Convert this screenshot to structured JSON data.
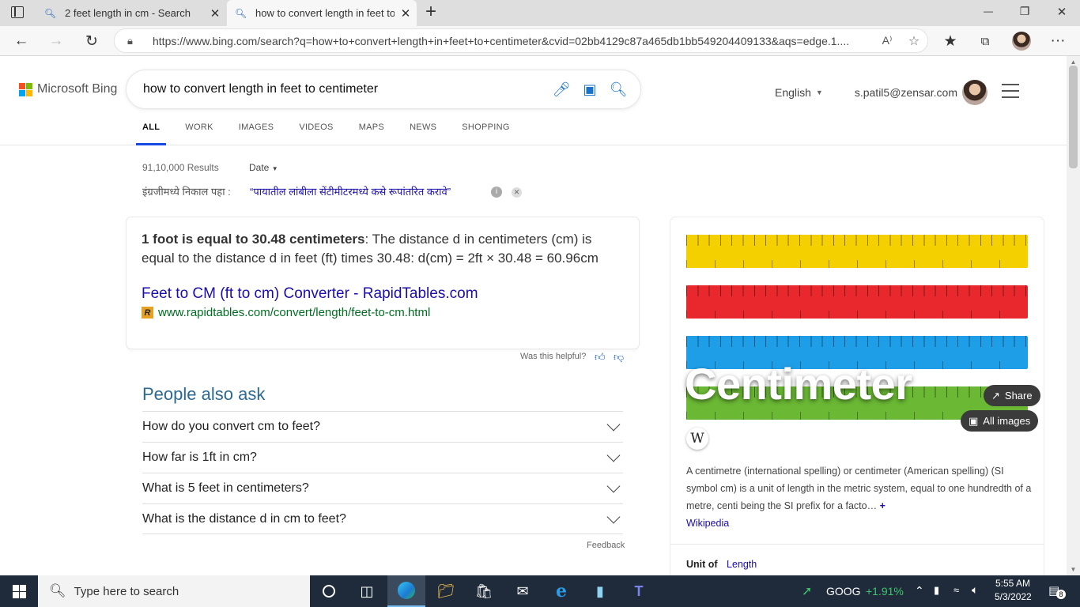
{
  "browser": {
    "tabs": [
      {
        "title": "2 feet length in cm - Search",
        "close": "✕"
      },
      {
        "title": "how to convert length in feet to c",
        "close": "✕"
      }
    ],
    "new_tab": "+",
    "window_controls": {
      "minimize": "—",
      "restore": "❐",
      "close": "✕"
    },
    "url": "https://www.bing.com/search?q=how+to+convert+length+in+feet+to+centimeter&cvid=02bb4129c87a465db1bb549204409133&aqs=edge.1....",
    "read_aloud": "A⁾",
    "menu": "···"
  },
  "bing": {
    "logo_text": "Microsoft Bing",
    "logo_colors": [
      "#f25022",
      "#7fba00",
      "#00a4ef",
      "#ffb900"
    ],
    "query": "how to convert length in feet to centimeter",
    "language": "English",
    "user_email": "s.patil5@zensar.com",
    "tabs": [
      "ALL",
      "WORK",
      "IMAGES",
      "VIDEOS",
      "MAPS",
      "NEWS",
      "SHOPPING"
    ],
    "results_count": "91,10,000 Results",
    "date_filter": "Date",
    "marathi_label": "इंग्रजीमध्ये निकाल पहा :",
    "marathi_link": "“पायातील लांबीला सेंटीमीटरमध्ये कसे रूपांतरित करावे”",
    "answer": {
      "bold": "1 foot is equal to 30.48 centimeters",
      "rest": ": The distance d in centimeters (cm) is equal to the distance d in feet (ft) times 30.48: d(cm) = 2ft × 30.48 = 60.96cm",
      "link_title": "Feet to CM (ft to cm) Converter - RapidTables.com",
      "link_icon_letter": "R",
      "link_url": "www.rapidtables.com/convert/length/feet-to-cm.html"
    },
    "helpful_label": "Was this helpful?",
    "paa_title": "People also ask",
    "paa": [
      "How do you convert cm to feet?",
      "How far is 1ft in cm?",
      "What is 5 feet in centimeters?",
      "What is the distance d in cm to feet?"
    ],
    "feedback": "Feedback",
    "knowledge": {
      "title": "Centimeter",
      "share": "Share",
      "all_images": "All images",
      "wiki_letter": "W",
      "description": "A centimetre (international spelling) or centimeter (American spelling) (SI symbol cm) is a unit of length in the metric system, equal to one hundredth of a metre, centi being the SI prefix for a facto…",
      "expand": "+",
      "source": "Wikipedia",
      "unit_of_label": "Unit of",
      "unit_of_value": "Length",
      "ruler_colors": [
        "#f5d000",
        "#e8282c",
        "#1f9ee8",
        "#6ab834"
      ]
    }
  },
  "taskbar": {
    "search_placeholder": "Type here to search",
    "stock_symbol": "GOOG",
    "stock_change": "+1.91%",
    "time": "5:55 AM",
    "date": "5/3/2022",
    "notification_count": "8"
  }
}
